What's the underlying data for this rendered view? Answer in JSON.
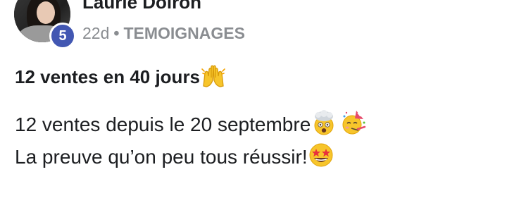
{
  "post": {
    "author": {
      "name": "Laurie Doiron",
      "badge": "5"
    },
    "meta": {
      "time": "22d",
      "group": "TEMOIGNAGES"
    },
    "title": "12 ventes en 40 jours",
    "body": {
      "line1": "12 ventes depuis le 20 septembre",
      "line2": "La preuve qu’on peu tous réussir!"
    },
    "emojis": [
      "raising-hands-icon",
      "exploding-head-icon",
      "partying-face-icon",
      "star-struck-icon"
    ]
  }
}
